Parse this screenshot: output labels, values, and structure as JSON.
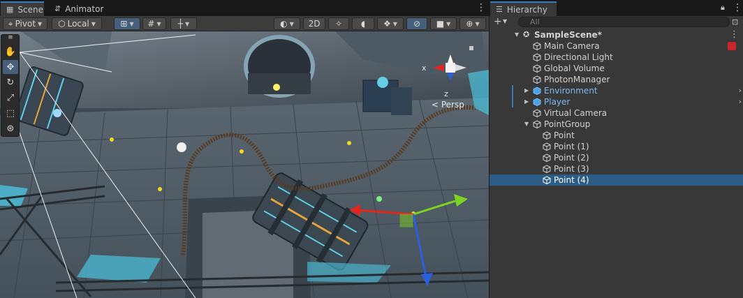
{
  "scene_tabs": {
    "scene": "Scene",
    "animator": "Animator"
  },
  "toolbar": {
    "pivot": "Pivot",
    "local": "Local",
    "mode_2d": "2D"
  },
  "viewport": {
    "persp_label": "< Persp",
    "gizmo_x": "x",
    "gizmo_z": "z"
  },
  "hierarchy": {
    "title": "Hierarchy",
    "search_placeholder": "All",
    "items": [
      {
        "label": "SampleScene*",
        "kind": "scene"
      },
      {
        "label": "Main Camera",
        "kind": "object"
      },
      {
        "label": "Directional Light",
        "kind": "object"
      },
      {
        "label": "Global Volume",
        "kind": "object"
      },
      {
        "label": "PhotonManager",
        "kind": "object"
      },
      {
        "label": "Environment",
        "kind": "prefab"
      },
      {
        "label": "Player",
        "kind": "prefab"
      },
      {
        "label": "Virtual Camera",
        "kind": "object"
      },
      {
        "label": "PointGroup",
        "kind": "object"
      },
      {
        "label": "Point",
        "kind": "object"
      },
      {
        "label": "Point (1)",
        "kind": "object"
      },
      {
        "label": "Point (2)",
        "kind": "object"
      },
      {
        "label": "Point (3)",
        "kind": "object"
      },
      {
        "label": "Point (4)",
        "kind": "object",
        "selected": true
      }
    ]
  },
  "colors": {
    "accent": "#3a79bb",
    "selection": "#2c5d87",
    "prefab_text": "#7ebaf2"
  }
}
